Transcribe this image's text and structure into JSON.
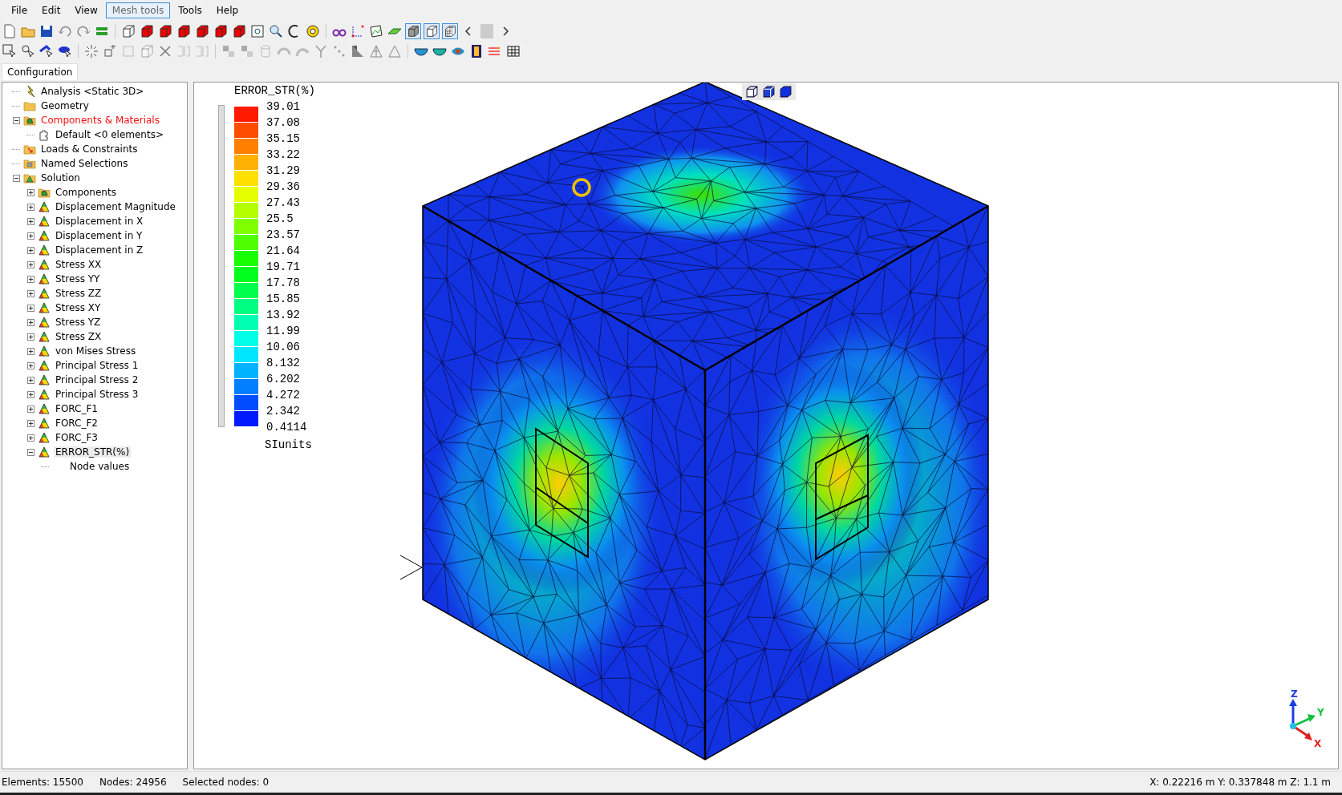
{
  "menu": [
    {
      "label": "File",
      "selected": false
    },
    {
      "label": "Edit",
      "selected": false
    },
    {
      "label": "View",
      "selected": false
    },
    {
      "label": "Mesh tools",
      "selected": true
    },
    {
      "label": "Tools",
      "selected": false
    },
    {
      "label": "Help",
      "selected": false
    }
  ],
  "tabs": [
    {
      "label": "Configuration",
      "selected": true
    }
  ],
  "tree": [
    {
      "label": "Analysis <Static 3D>",
      "kind": "analysis",
      "selected": false,
      "active": false
    },
    {
      "label": "Geometry",
      "kind": "folder",
      "selected": false,
      "active": false
    },
    {
      "label": "Components & Materials",
      "kind": "components",
      "expanded": true,
      "selected": false,
      "active": true,
      "children": [
        {
          "label": "Default <0 elements>",
          "kind": "part",
          "selected": false,
          "active": false
        }
      ]
    },
    {
      "label": "Loads & Constraints",
      "kind": "loads",
      "selected": false,
      "active": false
    },
    {
      "label": "Named Selections",
      "kind": "selections",
      "selected": false,
      "active": false
    },
    {
      "label": "Solution",
      "kind": "solution",
      "expanded": true,
      "selected": false,
      "active": false,
      "children": [
        {
          "label": "Components",
          "kind": "components",
          "expanded": false,
          "selected": false,
          "active": false
        },
        {
          "label": "Displacement Magnitude",
          "kind": "result",
          "expanded": false,
          "selected": false,
          "active": false
        },
        {
          "label": "Displacement in X",
          "kind": "result",
          "expanded": false,
          "selected": false,
          "active": false
        },
        {
          "label": "Displacement in Y",
          "kind": "result",
          "expanded": false,
          "selected": false,
          "active": false
        },
        {
          "label": "Displacement in Z",
          "kind": "result",
          "expanded": false,
          "selected": false,
          "active": false
        },
        {
          "label": "Stress XX",
          "kind": "result",
          "expanded": false,
          "selected": false,
          "active": false
        },
        {
          "label": "Stress YY",
          "kind": "result",
          "expanded": false,
          "selected": false,
          "active": false
        },
        {
          "label": "Stress ZZ",
          "kind": "result",
          "expanded": false,
          "selected": false,
          "active": false
        },
        {
          "label": "Stress XY",
          "kind": "result",
          "expanded": false,
          "selected": false,
          "active": false
        },
        {
          "label": "Stress YZ",
          "kind": "result",
          "expanded": false,
          "selected": false,
          "active": false
        },
        {
          "label": "Stress ZX",
          "kind": "result",
          "expanded": false,
          "selected": false,
          "active": false
        },
        {
          "label": "von Mises Stress",
          "kind": "result",
          "expanded": false,
          "selected": false,
          "active": false
        },
        {
          "label": "Principal Stress 1",
          "kind": "result",
          "expanded": false,
          "selected": false,
          "active": false
        },
        {
          "label": "Principal Stress 2",
          "kind": "result",
          "expanded": false,
          "selected": false,
          "active": false
        },
        {
          "label": "Principal Stress 3",
          "kind": "result",
          "expanded": false,
          "selected": false,
          "active": false
        },
        {
          "label": "FORC_F1",
          "kind": "result",
          "expanded": false,
          "selected": false,
          "active": false
        },
        {
          "label": "FORC_F2",
          "kind": "result",
          "expanded": false,
          "selected": false,
          "active": false
        },
        {
          "label": "FORC_F3",
          "kind": "result",
          "expanded": false,
          "selected": false,
          "active": false
        },
        {
          "label": "ERROR_STR(%)",
          "kind": "result",
          "expanded": true,
          "selected": true,
          "active": false,
          "children": [
            {
              "label": "Node values",
              "selected": false,
              "active": false
            }
          ]
        }
      ]
    }
  ],
  "legend": {
    "title": "ERROR_STR(%)",
    "units": "SIunits",
    "range": {
      "level": 1
    },
    "bands": [
      {
        "color": "#ff1a00"
      },
      {
        "color": "#ff4d00"
      },
      {
        "color": "#ff7f00"
      },
      {
        "color": "#ffb000"
      },
      {
        "color": "#ffe000"
      },
      {
        "color": "#e6ff00"
      },
      {
        "color": "#b3ff00"
      },
      {
        "color": "#80ff00"
      },
      {
        "color": "#4dff00"
      },
      {
        "color": "#1aff00"
      },
      {
        "color": "#00ff1a"
      },
      {
        "color": "#00ff4d"
      },
      {
        "color": "#00ff80"
      },
      {
        "color": "#00ffb3"
      },
      {
        "color": "#00ffe6"
      },
      {
        "color": "#00e6ff"
      },
      {
        "color": "#00b3ff"
      },
      {
        "color": "#0080ff"
      },
      {
        "color": "#004dff"
      },
      {
        "color": "#001aff"
      }
    ],
    "labels": [
      "39.01",
      "37.08",
      "35.15",
      "33.22",
      "31.29",
      "29.36",
      "27.43",
      "25.5",
      "23.57",
      "21.64",
      "19.71",
      "17.78",
      "15.85",
      "13.92",
      "11.99",
      "10.06",
      "8.132",
      "6.202",
      "4.272",
      "2.342",
      "0.4114"
    ]
  },
  "triad": {
    "x": "X",
    "y": "Y",
    "z": "Z"
  },
  "status_bar": {
    "elements": "Elements: 15500",
    "nodes": "Nodes: 24956",
    "selected": "Selected nodes: 0",
    "coords": "X: 0.22216 m Y: 0.337848 m Z: 1.1 m"
  }
}
